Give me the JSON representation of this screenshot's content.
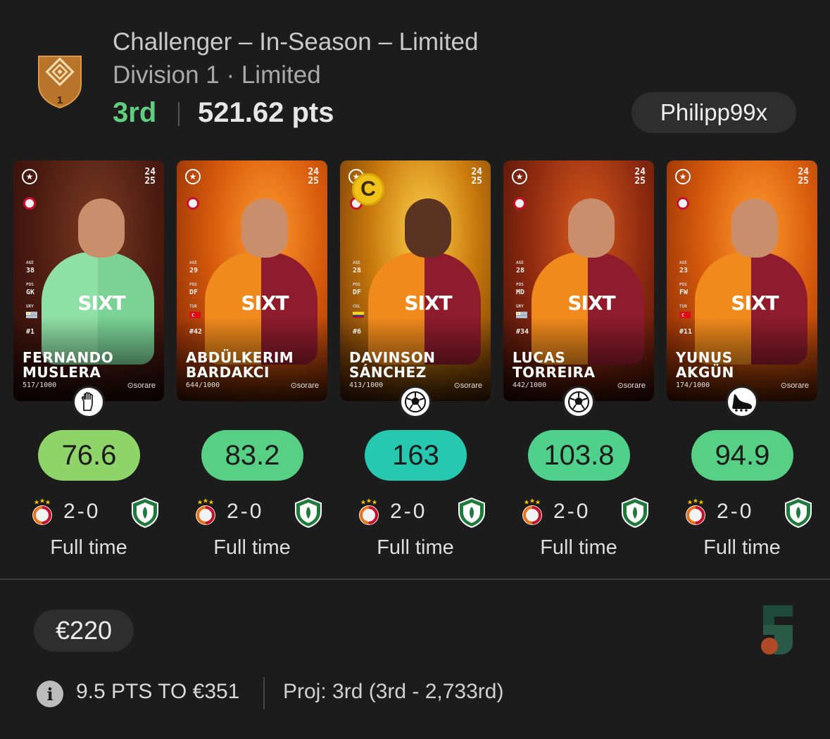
{
  "header": {
    "title": "Challenger – In-Season – Limited",
    "subtitle": "Division 1 · Limited",
    "rank": "3rd",
    "points": "521.62 pts",
    "username": "Philipp99x",
    "badge_number": "1"
  },
  "players": [
    {
      "first": "FERNANDO",
      "last": "MUSLERA",
      "serial": "517/1000",
      "season_top": "24",
      "season_bottom": "25",
      "age": "38",
      "pos": "GK",
      "nat": "URY",
      "number": "#1",
      "position_icon": "goalkeeper-glove-icon",
      "score": "76.6",
      "score_color": "#8fd468",
      "home_score": "2",
      "away_score": "0",
      "status": "Full time",
      "brand": "⊙sorare",
      "sponsor": "SIXT",
      "captain": false
    },
    {
      "first": "ABDÜLKERIM",
      "last": "BARDAKCI",
      "serial": "644/1000",
      "season_top": "24",
      "season_bottom": "25",
      "age": "29",
      "pos": "DF",
      "nat": "TUR",
      "number": "#42",
      "position_icon": "none",
      "score": "83.2",
      "score_color": "#57cf85",
      "home_score": "2",
      "away_score": "0",
      "status": "Full time",
      "brand": "⊙sorare",
      "sponsor": "SIXT",
      "captain": false
    },
    {
      "first": "DAVINSON",
      "last": "SÁNCHEZ",
      "serial": "413/1000",
      "season_top": "24",
      "season_bottom": "25",
      "age": "28",
      "pos": "DF",
      "nat": "COL",
      "number": "#6",
      "position_icon": "football-icon",
      "score": "163",
      "score_color": "#26c9b0",
      "home_score": "2",
      "away_score": "0",
      "status": "Full time",
      "brand": "⊙sorare",
      "sponsor": "SIXT",
      "captain": true,
      "captain_label": "C"
    },
    {
      "first": "LUCAS",
      "last": "TORREIRA",
      "serial": "442/1000",
      "season_top": "24",
      "season_bottom": "25",
      "age": "28",
      "pos": "MD",
      "nat": "URY",
      "number": "#34",
      "position_icon": "football-icon",
      "score": "103.8",
      "score_color": "#4fd08b",
      "home_score": "2",
      "away_score": "0",
      "status": "Full time",
      "brand": "⊙sorare",
      "sponsor": "SIXT",
      "captain": false
    },
    {
      "first": "YUNUS",
      "last": "AKGÜN",
      "serial": "174/1000",
      "season_top": "24",
      "season_bottom": "25",
      "age": "23",
      "pos": "FW",
      "nat": "TUR",
      "number": "#11",
      "position_icon": "football-boot-icon",
      "score": "94.9",
      "score_color": "#57cf85",
      "home_score": "2",
      "away_score": "0",
      "status": "Full time",
      "brand": "⊙sorare",
      "sponsor": "SIXT",
      "captain": false
    }
  ],
  "meta_labels": {
    "age": "AGE",
    "pos": "POS"
  },
  "footer": {
    "prize": "€220",
    "next_prize": "9.5 PTS TO €351",
    "projection": "Proj: 3rd (3rd - 2,733rd)"
  }
}
